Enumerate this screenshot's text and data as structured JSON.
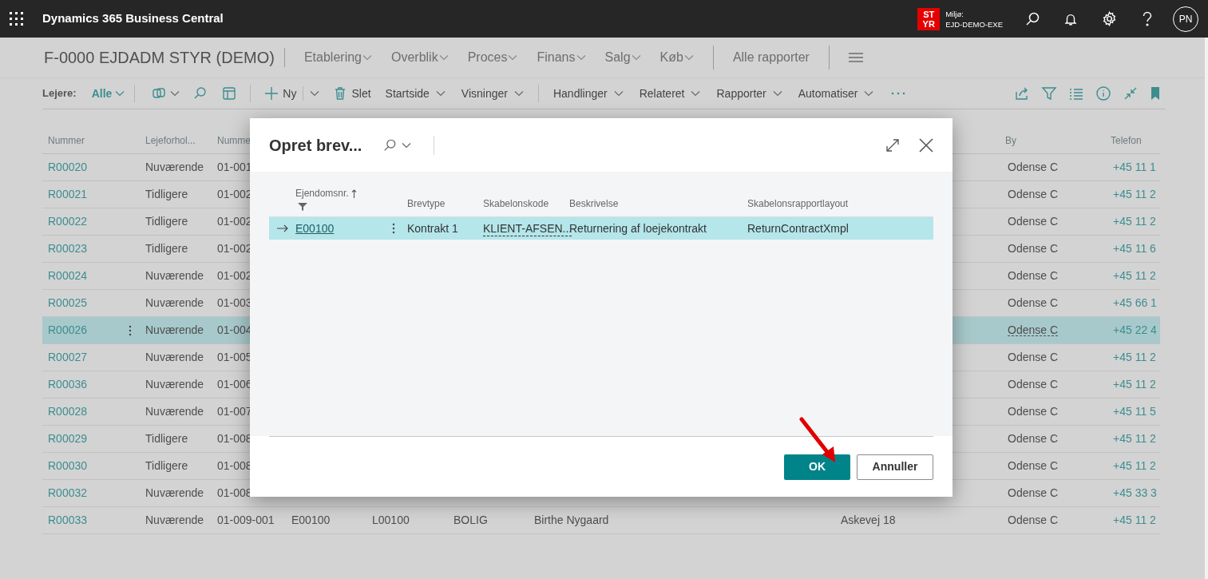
{
  "app_bar": {
    "title": "Dynamics 365 Business Central",
    "environment": {
      "badge_top": "ST",
      "badge_bottom": "YR",
      "label": "Miljø:",
      "name": "EJD-DEMO-EXE"
    },
    "avatar": "PN"
  },
  "nav": {
    "title": "F-0000 EJDADM STYR (DEMO)",
    "menus": [
      "Etablering",
      "Overblik",
      "Proces",
      "Finans",
      "Salg",
      "Køb"
    ],
    "link": "Alle rapporter"
  },
  "action_bar": {
    "filter_label": "Lejere:",
    "filter_value": "Alle",
    "actions": [
      {
        "kind": "copilot"
      },
      {
        "kind": "search"
      },
      {
        "kind": "layout"
      },
      {
        "kind": "separator"
      },
      {
        "kind": "new",
        "label": "Ny"
      },
      {
        "kind": "delete",
        "label": "Slet"
      },
      {
        "kind": "menu",
        "label": "Startside"
      },
      {
        "kind": "menu",
        "label": "Visninger"
      },
      {
        "kind": "separator"
      },
      {
        "kind": "menu",
        "label": "Handlinger"
      },
      {
        "kind": "menu",
        "label": "Relateret"
      },
      {
        "kind": "menu",
        "label": "Rapporter"
      },
      {
        "kind": "menu",
        "label": "Automatiser"
      },
      {
        "kind": "more"
      }
    ]
  },
  "list": {
    "columns": [
      "Nummer",
      "Lejeforhol...",
      "Numme",
      "By",
      "Telefon"
    ],
    "rows": [
      {
        "number": "R00020",
        "status": "Nuværende",
        "column_3": "01-001",
        "city": "Odense C",
        "phone": "+45 11 1",
        "selected": false
      },
      {
        "number": "R00021",
        "status": "Tidligere",
        "column_3": "01-002",
        "city": "Odense C",
        "phone": "+45 11 2",
        "selected": false
      },
      {
        "number": "R00022",
        "status": "Tidligere",
        "column_3": "01-002",
        "city": "Odense C",
        "phone": "+45 11 2",
        "selected": false
      },
      {
        "number": "R00023",
        "status": "Tidligere",
        "column_3": "01-002",
        "city": "Odense C",
        "phone": "+45 11 6",
        "selected": false
      },
      {
        "number": "R00024",
        "status": "Nuværende",
        "column_3": "01-002",
        "city": "Odense C",
        "phone": "+45 11 2",
        "selected": false
      },
      {
        "number": "R00025",
        "status": "Nuværende",
        "column_3": "01-003",
        "city": "Odense C",
        "phone": "+45 66 1",
        "selected": false
      },
      {
        "number": "R00026",
        "status": "Nuværende",
        "column_3": "01-004",
        "city": "Odense C",
        "phone": "+45 22 4",
        "selected": true
      },
      {
        "number": "R00027",
        "status": "Nuværende",
        "column_3": "01-005",
        "city": "Odense C",
        "phone": "+45 11 2",
        "selected": false
      },
      {
        "number": "R00036",
        "status": "Nuværende",
        "column_3": "01-006",
        "city": "Odense C",
        "phone": "+45 11 2",
        "selected": false
      },
      {
        "number": "R00028",
        "status": "Nuværende",
        "column_3": "01-007",
        "city": "Odense C",
        "phone": "+45 11 5",
        "selected": false
      },
      {
        "number": "R00029",
        "status": "Tidligere",
        "column_3": "01-008",
        "city": "Odense C",
        "phone": "+45 11 2",
        "selected": false
      },
      {
        "number": "R00030",
        "status": "Tidligere",
        "column_3": "01-008",
        "city": "Odense C",
        "phone": "+45 11 2",
        "selected": false
      },
      {
        "number": "R00032",
        "status": "Nuværende",
        "column_3": "01-008",
        "city": "Odense C",
        "phone": "+45 33 3",
        "selected": false
      },
      {
        "number": "R00033",
        "status": "Nuværende",
        "column_3": "01-009-001",
        "column_4": "E00100",
        "column_5": "L00100",
        "column_6": "BOLIG",
        "column_7": "Birthe Nygaard",
        "column_8": "Askevej 18",
        "city": "Odense C",
        "phone": "+45 11 2",
        "selected": false
      }
    ]
  },
  "dialog": {
    "title": "Opret brev...",
    "columns": [
      {
        "label": "Ejendomsnr.",
        "sorted": true,
        "filtered": true
      },
      {
        "label": "Brevtype",
        "sorted": false,
        "filtered": false
      },
      {
        "label": "Skabelonskode",
        "sorted": false,
        "filtered": false
      },
      {
        "label": "Beskrivelse",
        "sorted": false,
        "filtered": false
      },
      {
        "label": "Skabelonsrapportlayout",
        "sorted": false,
        "filtered": false
      }
    ],
    "rows": [
      {
        "property": "E00100",
        "letter_type": "Kontrakt 1",
        "template_code": "KLIENT-AFSEN...",
        "description": "Returnering af loejekontrakt",
        "layout": "ReturnContractXmpl",
        "selected": true
      }
    ],
    "buttons": [
      {
        "label": "OK",
        "kind": "primary"
      },
      {
        "label": "Annuller",
        "kind": "secondary"
      }
    ]
  }
}
